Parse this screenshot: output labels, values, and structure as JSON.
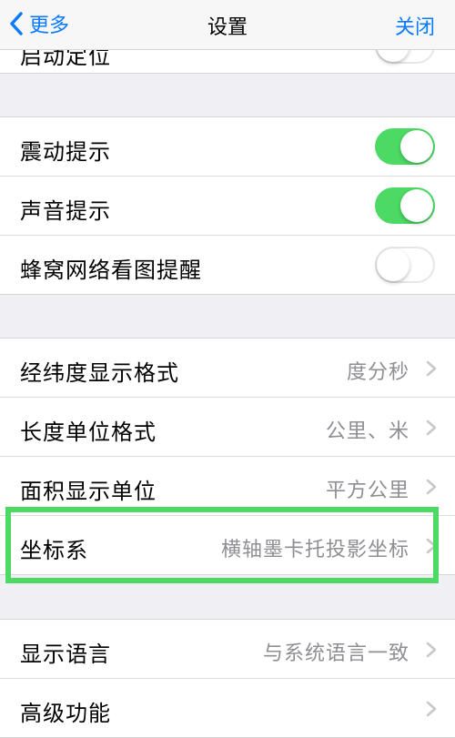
{
  "nav": {
    "back_label": "更多",
    "title": "设置",
    "close_label": "关闭"
  },
  "top_partial_row": {
    "label": "启动定位",
    "toggle": false
  },
  "group_alerts": [
    {
      "label": "震动提示",
      "toggle": true
    },
    {
      "label": "声音提示",
      "toggle": true
    },
    {
      "label": "蜂窝网络看图提醒",
      "toggle": false
    }
  ],
  "group_format": [
    {
      "label": "经纬度显示格式",
      "value": "度分秒"
    },
    {
      "label": "长度单位格式",
      "value": "公里、米"
    },
    {
      "label": "面积显示单位",
      "value": "平方公里"
    },
    {
      "label": "坐标系",
      "value": "横轴墨卡托投影坐标",
      "highlighted": true
    }
  ],
  "group_misc": [
    {
      "label": "显示语言",
      "value": "与系统语言一致"
    },
    {
      "label": "高级功能",
      "value": ""
    }
  ],
  "colors": {
    "accent": "#0a7aff",
    "toggle_on": "#4cd964",
    "highlight_border": "#4cd964",
    "background": "#efeff4"
  }
}
